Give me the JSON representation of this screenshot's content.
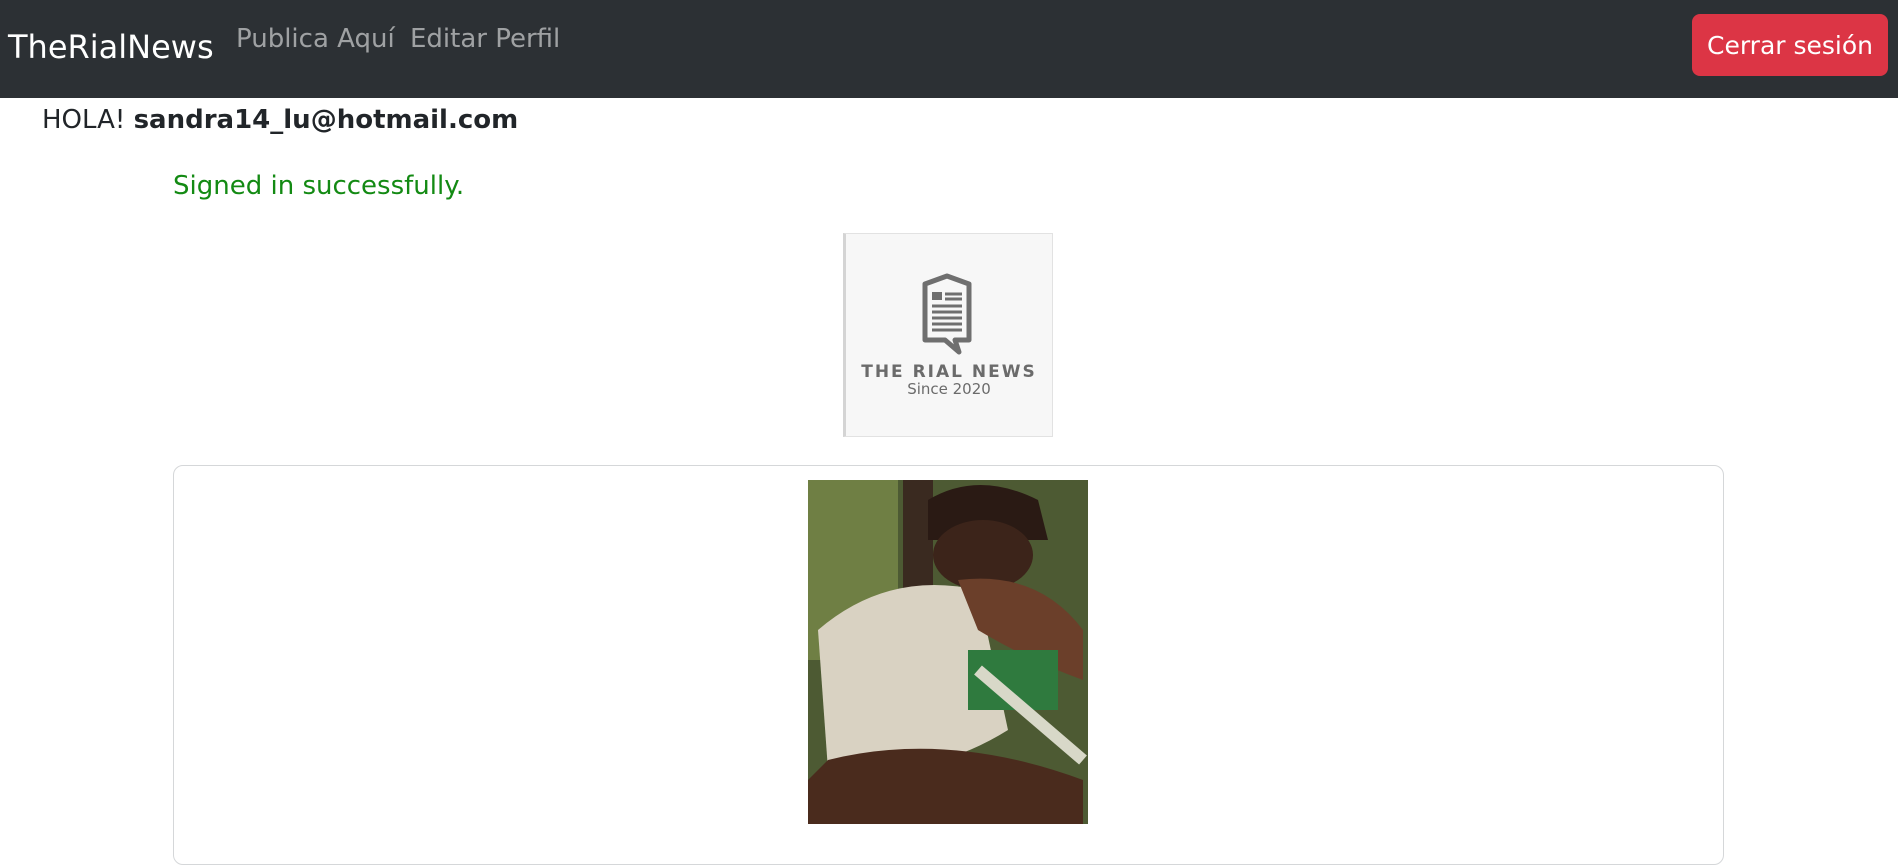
{
  "navbar": {
    "brand": "TheRialNews",
    "links": [
      {
        "label": "Publica Aquí"
      },
      {
        "label": "Editar Perfil"
      }
    ],
    "logout_label": "Cerrar sesión",
    "logout_color": "#dc3545",
    "background_color": "#2c3034"
  },
  "greeting": {
    "prefix": "HOLA!",
    "email": "sandra14_lu@hotmail.com"
  },
  "flash": {
    "message": "Signed in successfully.",
    "color": "#138a13"
  },
  "logo": {
    "icon": "newspaper-icon",
    "title": "THE RIAL NEWS",
    "subtitle": "Since 2020"
  },
  "card": {
    "image_description_icon": "photo-icon"
  }
}
